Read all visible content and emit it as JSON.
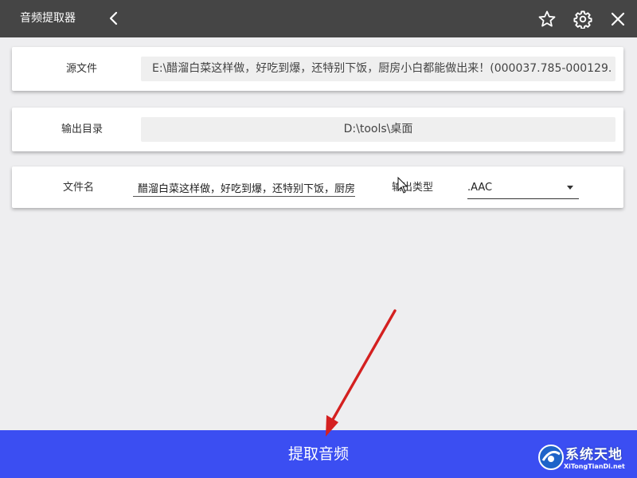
{
  "window": {
    "title": "音频提取器",
    "icons": [
      "back-icon",
      "star-icon",
      "gear-icon",
      "close-icon"
    ]
  },
  "source": {
    "label": "源文件",
    "value": "E:\\醋溜白菜这样做，好吃到爆，还特别下饭，厨房小白都能做出来！(000037.785-000129."
  },
  "output_dir": {
    "label": "输出目录",
    "value": "D:\\tools\\桌面"
  },
  "filename": {
    "label": "文件名",
    "value": "醋溜白菜这样做，好吃到爆，还特别下饭，厨房小白"
  },
  "output_type": {
    "label": "输出类型",
    "selected": ".AAC"
  },
  "action": {
    "extract_label": "提取音频"
  },
  "colors": {
    "titlebar": "#454545",
    "primary_button": "#3b4ef2",
    "annotation_arrow": "#d42020"
  },
  "watermark": {
    "text": "系统天地",
    "sub": "XiTongTianDi.net"
  }
}
